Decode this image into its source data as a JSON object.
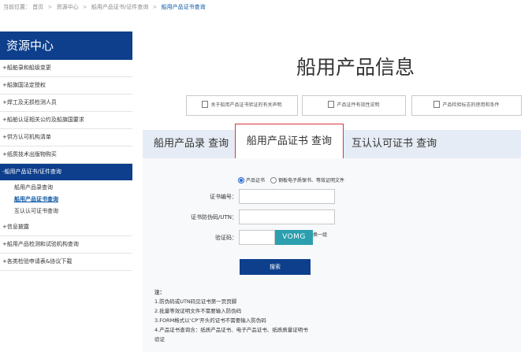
{
  "breadcrumb": {
    "prefix": "当前位置：",
    "items": [
      "首页",
      "资源中心",
      "船用产品证书/证件查询"
    ],
    "current": "船用产品证书查询",
    "sep": ">"
  },
  "sidebar": {
    "title": "资源中心",
    "items": [
      {
        "label": "+船舶录和船级变更"
      },
      {
        "label": "+船旗国法定授权"
      },
      {
        "label": "+焊工及无损检测人员"
      },
      {
        "label": "+船舶认证相关公约及船旗国要求"
      },
      {
        "label": "+供方认可机构清单"
      },
      {
        "label": "+纸质技术出版物购买"
      },
      {
        "label": "-船用产品证书/证件查询",
        "active": true
      },
      {
        "label": "+信息披露"
      },
      {
        "label": "+船用产品检测和试验机构查询"
      },
      {
        "label": "+各类检验申请表&协议下载"
      }
    ],
    "sub_items": [
      {
        "label": "船用产品录查询",
        "active": false
      },
      {
        "label": "船用产品证书查询",
        "active": true
      },
      {
        "label": "互认认可证书查询",
        "active": false
      }
    ]
  },
  "main": {
    "title": "船用产品信息",
    "doc_links": [
      "关于船用产品证书验证的有关声明",
      "产品证件有效性说明",
      "产品检验标志的使用和条件"
    ],
    "tabs": [
      {
        "label": "船用产品录 查询"
      },
      {
        "label": "船用产品证书 查询",
        "active": true
      },
      {
        "label": "互认认可证书 查询"
      }
    ]
  },
  "form": {
    "radio_options": [
      "产品证书",
      "钢板电子质保书、等效证明文件"
    ],
    "cert_no_label": "证书编号：",
    "anti_fake_label": "证书防伪码/UTN：",
    "captcha_label": "验证码：",
    "captcha_text": "VOMG",
    "refresh_label": "换一组",
    "search_button": "搜索"
  },
  "notes": {
    "heading": "注：",
    "lines": [
      "1.防伪码或UTN码见证书第一页页脚",
      "2.批量等效证明文件不需要输入防伪码",
      "3.FORM格式以‘CP’开头的证书不需要输入防伪码",
      "4.产品证书查询含：纸质产品证书、电子产品证书、纸质质量证明书验证"
    ]
  },
  "colors": {
    "brand_blue": "#0d3f8c",
    "tab_bar": "#e6ecf5",
    "active_tab_border": "#d9363e",
    "captcha_bg": "#2b9fae"
  }
}
